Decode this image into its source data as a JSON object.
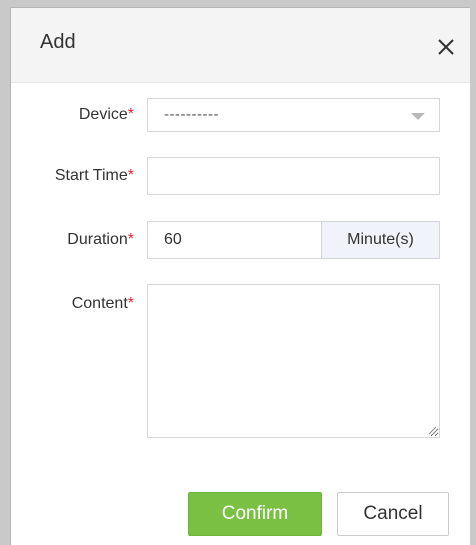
{
  "dialog": {
    "title": "Add",
    "close_symbol": "×"
  },
  "form": {
    "device": {
      "label": "Device",
      "required_mark": "*",
      "selected_value": "----------",
      "caret_icon": "chevron-down-icon"
    },
    "start_time": {
      "label": "Start Time",
      "required_mark": "*",
      "value": ""
    },
    "duration": {
      "label": "Duration",
      "required_mark": "*",
      "value": "60",
      "unit": "Minute(s)"
    },
    "content": {
      "label": "Content",
      "required_mark": "*",
      "value": ""
    }
  },
  "footer": {
    "confirm_label": "Confirm",
    "cancel_label": "Cancel"
  },
  "colors": {
    "confirm_bg": "#7ac143",
    "required": "#e02a2a",
    "header_bg": "#f4f4f4",
    "addon_bg": "#f0f4fa"
  }
}
